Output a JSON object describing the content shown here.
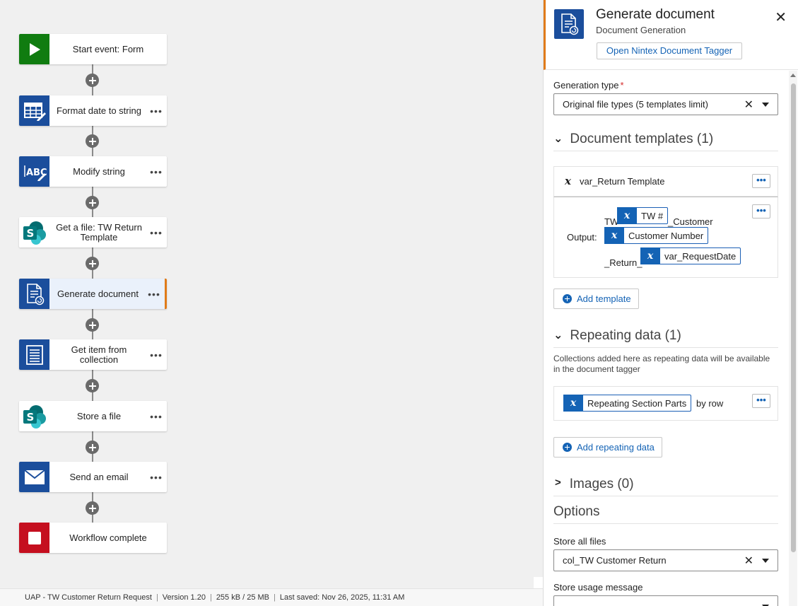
{
  "workflow": {
    "steps": [
      {
        "label": "Start event: Form",
        "icon": "play-icon",
        "color": "#107c10",
        "has_menu": false
      },
      {
        "label": "Format date to string",
        "icon": "calendar-edit-icon",
        "color": "#1b4e9c",
        "has_menu": true
      },
      {
        "label": "Modify string",
        "icon": "abc-edit-icon",
        "color": "#1b4e9c",
        "has_menu": true
      },
      {
        "label": "Get a file: TW Return Template",
        "icon": "sharepoint-icon",
        "color": "#ffffff",
        "has_menu": true
      },
      {
        "label": "Generate document",
        "icon": "document-generate-icon",
        "color": "#1b4e9c",
        "has_menu": true,
        "selected": true
      },
      {
        "label": "Get item from collection",
        "icon": "list-icon",
        "color": "#1b4e9c",
        "has_menu": true
      },
      {
        "label": "Store a file",
        "icon": "sharepoint-icon",
        "color": "#ffffff",
        "has_menu": true
      },
      {
        "label": "Send an email",
        "icon": "envelope-icon",
        "color": "#1b4e9c",
        "has_menu": true
      },
      {
        "label": "Workflow complete",
        "icon": "stop-icon",
        "color": "#c50f1f",
        "has_menu": false
      }
    ],
    "menu_glyph": "•••"
  },
  "status_bar": {
    "name": "UAP - TW Customer Return Request",
    "version": "Version 1.20",
    "size": "255 kB / 25 MB",
    "saved": "Last saved: Nov 26, 2025, 11:31 AM"
  },
  "panel": {
    "title": "Generate document",
    "subtitle": "Document Generation",
    "tagger_button": "Open Nintex Document Tagger",
    "generation_type": {
      "label": "Generation type",
      "value": "Original file types (5 templates limit)"
    },
    "document_templates": {
      "title": "Document templates (1)",
      "template_name": "var_Return Template",
      "output_label": "Output:",
      "output_text_1": "TW",
      "output_var_1": "TW #",
      "output_text_2": "_Customer",
      "output_var_2": "Customer Number",
      "output_text_3": "_Return_",
      "output_var_3": "var_RequestDate",
      "add_label": "Add template"
    },
    "repeating_data": {
      "title": "Repeating data (1)",
      "help": "Collections added here as repeating data will be available in the document tagger",
      "var_name": "Repeating Section Parts",
      "suffix": "by row",
      "add_label": "Add repeating data"
    },
    "images": {
      "title": "Images (0)"
    },
    "options": {
      "title": "Options",
      "store_all_label": "Store all files",
      "store_all_value": "col_TW Customer Return",
      "usage_label": "Store usage message"
    },
    "x_glyph": "x",
    "close_glyph": "✕",
    "clear_glyph": "✕",
    "dots": "•••",
    "chevron_down": "⌄",
    "chevron_right": ">"
  }
}
